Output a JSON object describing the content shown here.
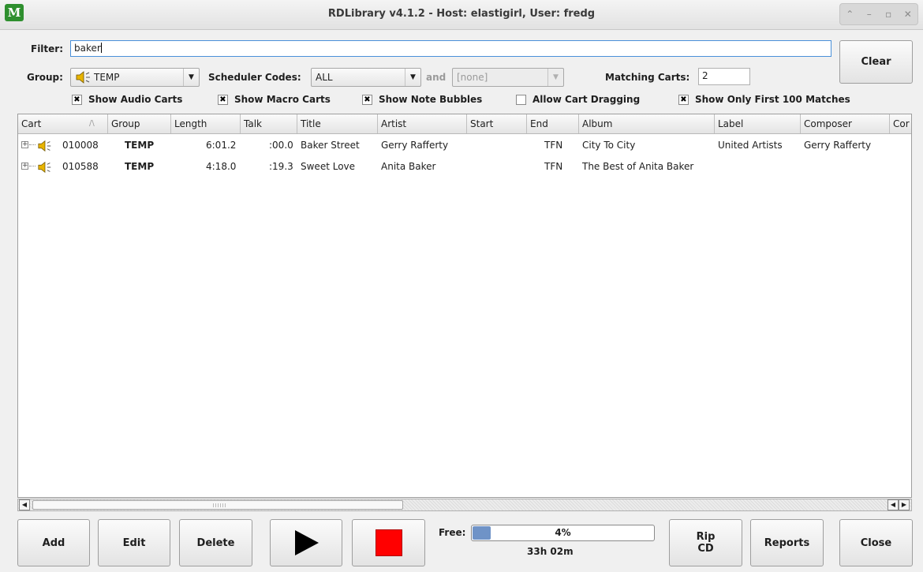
{
  "window": {
    "title": "RDLibrary v4.1.2 - Host: elastigirl, User: fredg",
    "icon_name": "rdlibrary-app-icon",
    "controls": [
      "⌃",
      "–",
      "▫",
      "✕"
    ]
  },
  "filter": {
    "label": "Filter:",
    "value": "baker"
  },
  "clear_button": "Clear",
  "group": {
    "label": "Group:",
    "value": "TEMP"
  },
  "scheduler": {
    "label": "Scheduler Codes:",
    "value": "ALL",
    "and_label": "and",
    "second_value": "[none]"
  },
  "matching": {
    "label": "Matching Carts:",
    "value": "2"
  },
  "checkboxes": [
    {
      "label": "Show Audio Carts",
      "checked": true
    },
    {
      "label": "Show Macro Carts",
      "checked": true
    },
    {
      "label": "Show Note Bubbles",
      "checked": true
    },
    {
      "label": "Allow Cart Dragging",
      "checked": false
    },
    {
      "label": "Show Only First 100 Matches",
      "checked": true
    }
  ],
  "table": {
    "columns": [
      "Cart",
      "Group",
      "Length",
      "Talk",
      "Title",
      "Artist",
      "Start",
      "End",
      "Album",
      "Label",
      "Composer",
      "Cor"
    ],
    "sort_indicator": "/\\",
    "rows": [
      {
        "cart": "010008",
        "group": "TEMP",
        "length": "6:01.2",
        "talk": ":00.0",
        "title": "Baker Street",
        "artist": "Gerry Rafferty",
        "start": "",
        "end": "TFN",
        "album": "City To City",
        "label": "United Artists",
        "composer": "Gerry Rafferty"
      },
      {
        "cart": "010588",
        "group": "TEMP",
        "length": "4:18.0",
        "talk": ":19.3",
        "title": "Sweet Love",
        "artist": "Anita Baker",
        "start": "",
        "end": "TFN",
        "album": "The Best of Anita Baker",
        "label": "",
        "composer": ""
      }
    ]
  },
  "scrollbar": {
    "left": "◀",
    "right_a": "◀",
    "right_b": "▶"
  },
  "buttons": {
    "add": "Add",
    "edit": "Edit",
    "delete": "Delete",
    "rip_line1": "Rip",
    "rip_line2": "CD",
    "reports": "Reports",
    "close": "Close"
  },
  "free": {
    "label": "Free:",
    "percent_text": "4%",
    "fraction": 0.04,
    "time": "33h 02m"
  },
  "colors": {
    "accent": "#4a90d9",
    "stop": "#ff0000",
    "free_bar": "#6f93c7",
    "app_icon": "#2e8f2e"
  }
}
